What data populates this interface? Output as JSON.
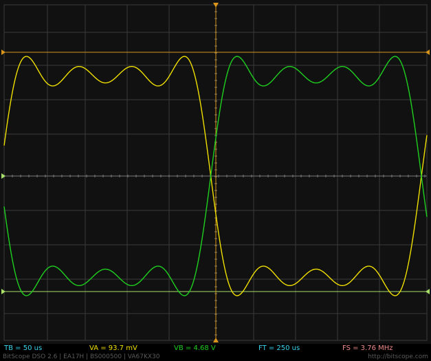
{
  "colors": {
    "background": "#111111",
    "grid": "#3a3a3a",
    "center_axis": "#7a7a7a",
    "channel_a": "#f0e000",
    "channel_b": "#1fd11f",
    "cursor": "#d9961a",
    "cursor_b": "#a8e06a",
    "tb": "#38d4ec",
    "va": "#f0e000",
    "vb": "#1fd11f",
    "ft": "#38d4ec",
    "fs": "#f08a8a"
  },
  "status": {
    "tb": "TB = 50 us",
    "va": "VA = 93.7 mV",
    "vb": "VB = 4.68 V",
    "ft": "FT = 250 us",
    "fs": "FS = 3.76 MHz"
  },
  "footer": {
    "info": "BitScope DSO 2.6 | EA17H | BS000500 | VA67KX30",
    "url": "http://bitscope.com"
  },
  "chart_data": {
    "type": "line",
    "series": [
      {
        "name": "A",
        "color": "#f0e000",
        "harmonics": [
          1,
          3,
          5,
          7
        ],
        "phase_deg": 0
      },
      {
        "name": "B",
        "color": "#1fd11f",
        "harmonics": [
          1,
          3,
          5,
          7
        ],
        "phase_deg": 180
      }
    ],
    "periods_shown": 2,
    "grid": true
  }
}
